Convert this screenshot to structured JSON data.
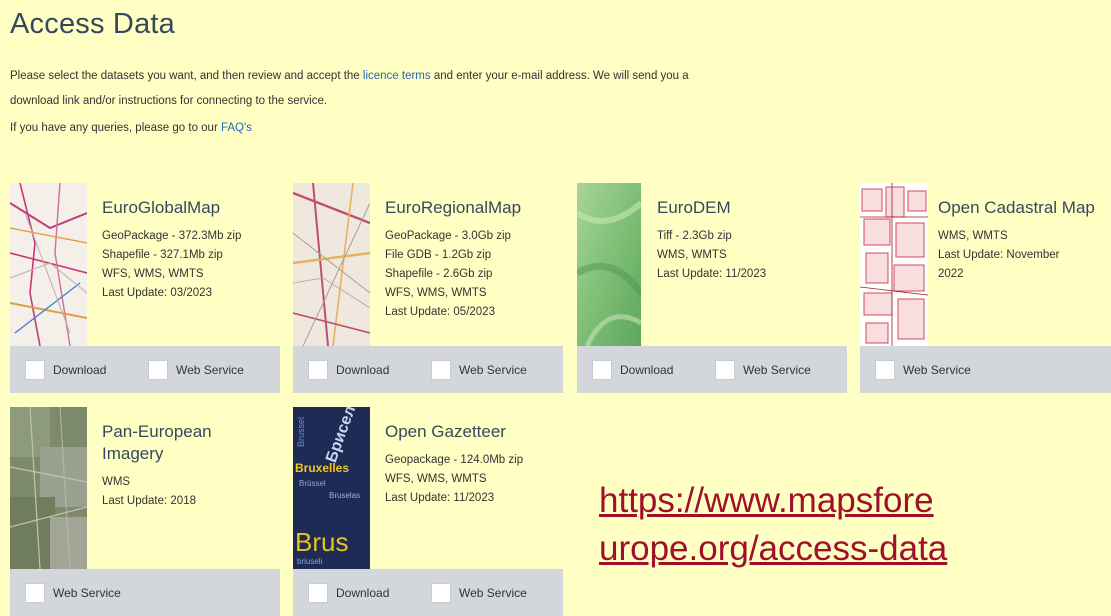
{
  "title": "Access Data",
  "intro": {
    "text_before": "Please select the datasets you want, and then review and accept the ",
    "licence_link": "licence terms",
    "text_after": " and enter your e-mail address. We will send you a download link and/or instructions for connecting to the service."
  },
  "queries": {
    "text": "If you have any queries, please go to our ",
    "faq_link": "FAQ's"
  },
  "download_label": "Download",
  "web_service_label": "Web Service",
  "cards": [
    {
      "name": "EuroGlobalMap",
      "lines": [
        "GeoPackage - 372.3Mb zip",
        "Shapefile - 327.1Mb zip",
        "WFS, WMS, WMTS",
        "Last Update: 03/2023"
      ]
    },
    {
      "name": "EuroRegionalMap",
      "lines": [
        "GeoPackage - 3.0Gb zip",
        "File GDB - 1.2Gb zip",
        "Shapefile - 2.6Gb zip",
        "WFS, WMS, WMTS",
        "Last Update: 05/2023"
      ]
    },
    {
      "name": "EuroDEM",
      "lines": [
        "Tiff - 2.3Gb zip",
        "WMS, WMTS",
        "Last Update: 11/2023"
      ]
    },
    {
      "name": "Open Cadastral Map",
      "lines": [
        "WMS, WMTS",
        "Last Update: November",
        "2022"
      ]
    },
    {
      "name": "Pan-European Imagery",
      "lines": [
        "WMS",
        "Last Update: 2018"
      ]
    },
    {
      "name": "Open Gazetteer",
      "lines": [
        "Geopackage - 124.0Mb zip",
        "WFS, WMS, WMTS",
        "Last Update: 11/2023"
      ]
    }
  ],
  "gazetteer_thumb_words": [
    "Bruxelles",
    "Брисел",
    "Brus",
    "Brussel",
    "Bruselas",
    "Brüssel",
    "briuseli"
  ],
  "url": "https://www.mapsforeurope.org/access-data",
  "url_line1": "https://www.mapsfore",
  "url_line2": "urope.org/access-data"
}
